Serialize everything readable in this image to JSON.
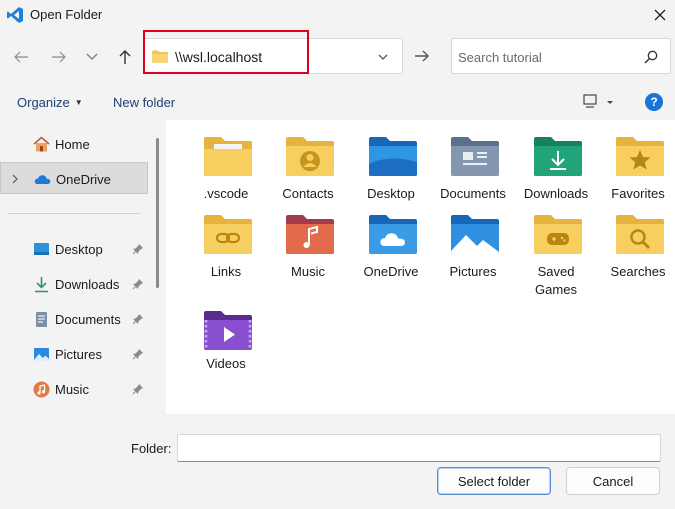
{
  "window": {
    "title": "Open Folder",
    "app_icon": "vscode-icon",
    "close_icon": "close-icon"
  },
  "nav": {
    "back_icon": "arrow-left-icon",
    "forward_icon": "arrow-right-icon",
    "recent_icon": "chevron-down-icon",
    "up_icon": "arrow-up-icon",
    "address_value": "\\\\wsl.localhost",
    "go_icon": "arrow-right-icon",
    "search_placeholder": "Search tutorial",
    "search_icon": "search-icon"
  },
  "toolbar": {
    "organize_label": "Organize",
    "new_folder_label": "New folder",
    "view_icon": "view-options-icon",
    "help_label": "?"
  },
  "sidebar": {
    "items": [
      {
        "label": "Home",
        "icon": "home-icon",
        "pinned": false
      },
      {
        "label": "OneDrive",
        "icon": "onedrive-icon",
        "pinned": false,
        "selected": true
      },
      {
        "label": "Desktop",
        "icon": "desktop-icon",
        "pinned": true
      },
      {
        "label": "Downloads",
        "icon": "downloads-icon",
        "pinned": true
      },
      {
        "label": "Documents",
        "icon": "documents-icon",
        "pinned": true
      },
      {
        "label": "Pictures",
        "icon": "pictures-icon",
        "pinned": true
      },
      {
        "label": "Music",
        "icon": "music-icon",
        "pinned": true
      }
    ]
  },
  "folders": [
    {
      "label": ".vscode",
      "icon": "folder-icon"
    },
    {
      "label": "Contacts",
      "icon": "contacts-folder-icon"
    },
    {
      "label": "Desktop",
      "icon": "desktop-folder-icon"
    },
    {
      "label": "Documents",
      "icon": "documents-folder-icon"
    },
    {
      "label": "Downloads",
      "icon": "downloads-folder-icon"
    },
    {
      "label": "Favorites",
      "icon": "favorites-folder-icon"
    },
    {
      "label": "Links",
      "icon": "links-folder-icon"
    },
    {
      "label": "Music",
      "icon": "music-folder-icon"
    },
    {
      "label": "OneDrive",
      "icon": "onedrive-folder-icon"
    },
    {
      "label": "Pictures",
      "icon": "pictures-folder-icon"
    },
    {
      "label": "Saved Games",
      "icon": "saved-games-folder-icon"
    },
    {
      "label": "Searches",
      "icon": "searches-folder-icon"
    },
    {
      "label": "Videos",
      "icon": "videos-folder-icon"
    }
  ],
  "footer": {
    "folder_label": "Folder:",
    "folder_value": "",
    "select_label": "Select folder",
    "cancel_label": "Cancel"
  },
  "colors": {
    "highlight_box": "#e0001b",
    "accent": "#1a73d9",
    "folder_yellow": "#f3c652"
  }
}
